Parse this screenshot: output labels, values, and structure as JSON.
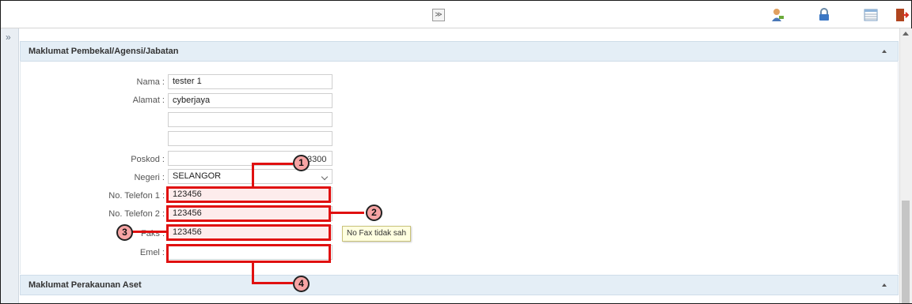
{
  "toolbar": {
    "collapse_glyph": "≫",
    "icons": [
      "user-icon",
      "lock-icon",
      "table-icon",
      "logout-icon"
    ]
  },
  "sidebar": {
    "expand_glyph": "»"
  },
  "section1": {
    "title": "Maklumat Pembekal/Agensi/Jabatan",
    "fields": {
      "nama_label": "Nama :",
      "nama_value": "tester 1",
      "alamat_label": "Alamat :",
      "alamat1_value": "cyberjaya",
      "alamat2_value": "",
      "alamat3_value": "",
      "poskod_label": "Poskod :",
      "poskod_value": "",
      "poskod_partial": "3300",
      "negeri_label": "Negeri :",
      "negeri_value": "SELANGOR",
      "tel1_label": "No. Telefon 1 :",
      "tel1_value": "123456",
      "tel2_label": "No. Telefon 2 :",
      "tel2_value": "123456",
      "faks_label": "Faks :",
      "faks_value": "123456",
      "emel_label": "Emel :",
      "emel_value": ""
    },
    "tooltip": "No Fax tidak sah"
  },
  "section2": {
    "title": "Maklumat Perakaunan Aset"
  },
  "callouts": [
    "1",
    "2",
    "3",
    "4"
  ],
  "colors": {
    "highlight": "#e01010",
    "callout_fill": "#f6a4a4",
    "panel_header": "#e4eef6"
  }
}
